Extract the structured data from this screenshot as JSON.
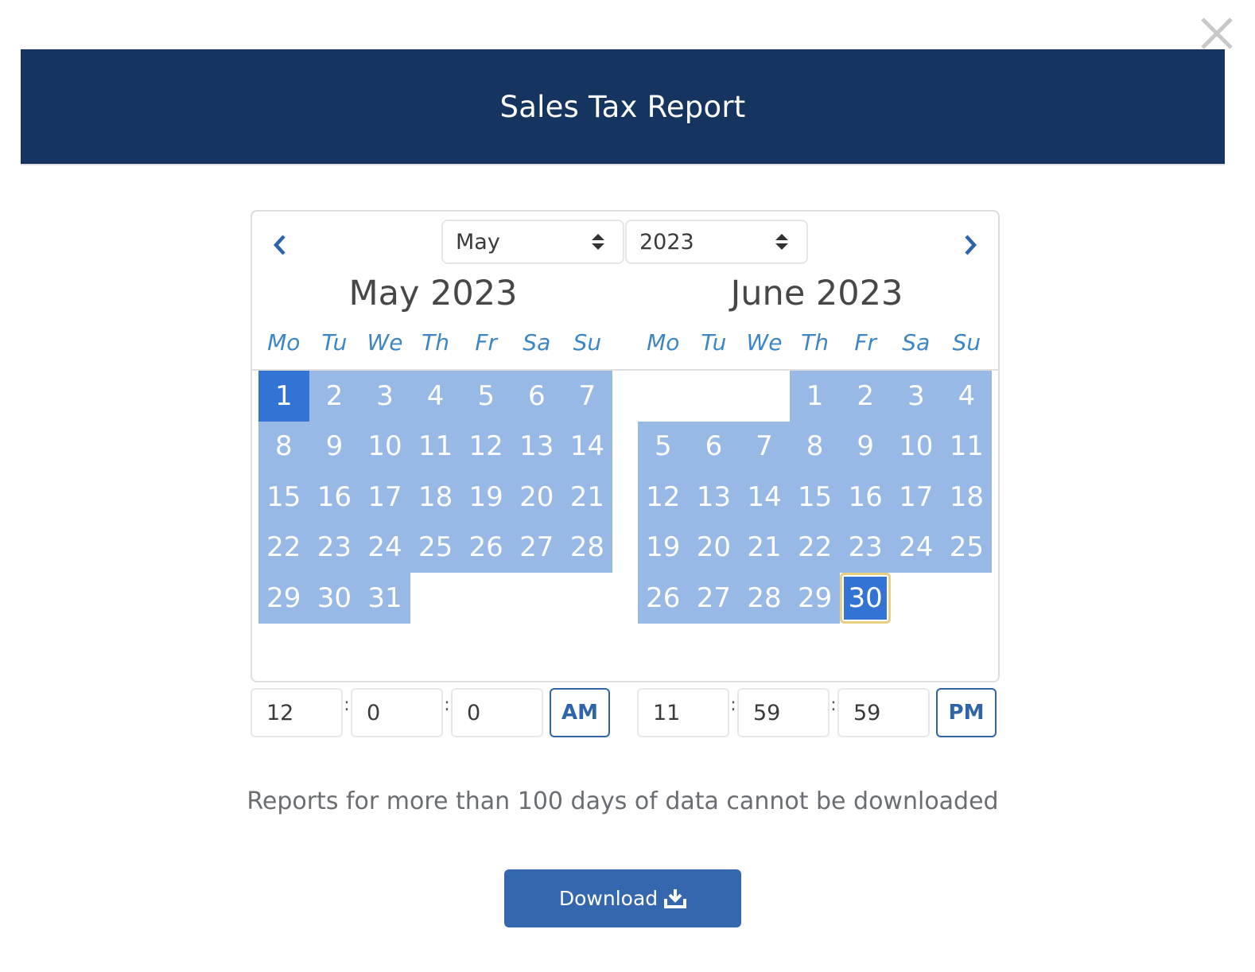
{
  "dialog": {
    "title": "Sales Tax Report",
    "close_label": "Close"
  },
  "datepicker": {
    "month_select": {
      "value": "May"
    },
    "year_select": {
      "value": "2023"
    },
    "weekdays": [
      "Mo",
      "Tu",
      "We",
      "Th",
      "Fr",
      "Sa",
      "Su"
    ],
    "months": [
      {
        "title": "May 2023",
        "leading_blanks": 0,
        "days": 31,
        "selection": {
          "start": 1,
          "range_from": 1,
          "range_to": 31
        }
      },
      {
        "title": "June 2023",
        "leading_blanks": 3,
        "days": 30,
        "selection": {
          "end": 30,
          "range_from": 1,
          "range_to": 30
        }
      }
    ],
    "colors": {
      "range": "#98b8e6",
      "selected": "#3273d4",
      "end_outline": "#e7cf83",
      "weekday_text": "#3d86c6"
    }
  },
  "start_time": {
    "hour": "12",
    "minute": "0",
    "second": "0",
    "meridiem": "AM"
  },
  "end_time": {
    "hour": "11",
    "minute": "59",
    "second": "59",
    "meridiem": "PM"
  },
  "note": "Reports for more than 100 days of data cannot be downloaded",
  "download_button": {
    "label": "Download"
  }
}
